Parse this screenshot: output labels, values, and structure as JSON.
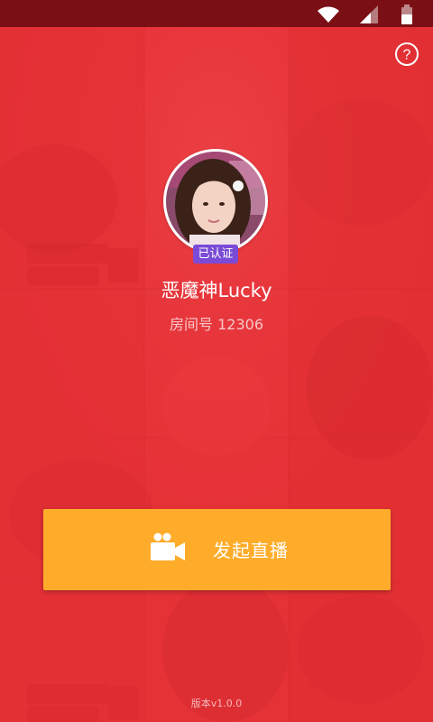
{
  "status_bar": {
    "icons": [
      "wifi-icon",
      "signal-icon",
      "battery-icon"
    ],
    "background_color": "#7a1015"
  },
  "header": {
    "help_icon": "question-circle-icon",
    "help_symbol": "?"
  },
  "profile": {
    "verified_label": "已认证",
    "name": "恶魔神Lucky",
    "room_label": "房间号",
    "room_number": "12306"
  },
  "actions": {
    "start_live_label": "发起直播",
    "start_live_icon": "video-camera-icon"
  },
  "footer": {
    "version": "版本v1.0.0"
  },
  "colors": {
    "background": "#e63035",
    "primary_button": "#feac29",
    "verified_badge": "#7a4bd6",
    "text_primary": "#ffffff",
    "text_secondary": "#f7c7c9"
  }
}
